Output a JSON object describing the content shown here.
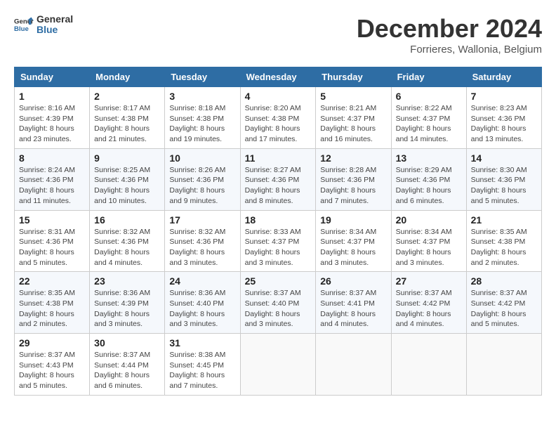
{
  "header": {
    "logo_general": "General",
    "logo_blue": "Blue",
    "month_year": "December 2024",
    "location": "Forrieres, Wallonia, Belgium"
  },
  "days_of_week": [
    "Sunday",
    "Monday",
    "Tuesday",
    "Wednesday",
    "Thursday",
    "Friday",
    "Saturday"
  ],
  "weeks": [
    [
      {
        "day": "1",
        "sunrise": "8:16 AM",
        "sunset": "4:39 PM",
        "daylight": "8 hours and 23 minutes."
      },
      {
        "day": "2",
        "sunrise": "8:17 AM",
        "sunset": "4:38 PM",
        "daylight": "8 hours and 21 minutes."
      },
      {
        "day": "3",
        "sunrise": "8:18 AM",
        "sunset": "4:38 PM",
        "daylight": "8 hours and 19 minutes."
      },
      {
        "day": "4",
        "sunrise": "8:20 AM",
        "sunset": "4:38 PM",
        "daylight": "8 hours and 17 minutes."
      },
      {
        "day": "5",
        "sunrise": "8:21 AM",
        "sunset": "4:37 PM",
        "daylight": "8 hours and 16 minutes."
      },
      {
        "day": "6",
        "sunrise": "8:22 AM",
        "sunset": "4:37 PM",
        "daylight": "8 hours and 14 minutes."
      },
      {
        "day": "7",
        "sunrise": "8:23 AM",
        "sunset": "4:36 PM",
        "daylight": "8 hours and 13 minutes."
      }
    ],
    [
      {
        "day": "8",
        "sunrise": "8:24 AM",
        "sunset": "4:36 PM",
        "daylight": "8 hours and 11 minutes."
      },
      {
        "day": "9",
        "sunrise": "8:25 AM",
        "sunset": "4:36 PM",
        "daylight": "8 hours and 10 minutes."
      },
      {
        "day": "10",
        "sunrise": "8:26 AM",
        "sunset": "4:36 PM",
        "daylight": "8 hours and 9 minutes."
      },
      {
        "day": "11",
        "sunrise": "8:27 AM",
        "sunset": "4:36 PM",
        "daylight": "8 hours and 8 minutes."
      },
      {
        "day": "12",
        "sunrise": "8:28 AM",
        "sunset": "4:36 PM",
        "daylight": "8 hours and 7 minutes."
      },
      {
        "day": "13",
        "sunrise": "8:29 AM",
        "sunset": "4:36 PM",
        "daylight": "8 hours and 6 minutes."
      },
      {
        "day": "14",
        "sunrise": "8:30 AM",
        "sunset": "4:36 PM",
        "daylight": "8 hours and 5 minutes."
      }
    ],
    [
      {
        "day": "15",
        "sunrise": "8:31 AM",
        "sunset": "4:36 PM",
        "daylight": "8 hours and 5 minutes."
      },
      {
        "day": "16",
        "sunrise": "8:32 AM",
        "sunset": "4:36 PM",
        "daylight": "8 hours and 4 minutes."
      },
      {
        "day": "17",
        "sunrise": "8:32 AM",
        "sunset": "4:36 PM",
        "daylight": "8 hours and 3 minutes."
      },
      {
        "day": "18",
        "sunrise": "8:33 AM",
        "sunset": "4:37 PM",
        "daylight": "8 hours and 3 minutes."
      },
      {
        "day": "19",
        "sunrise": "8:34 AM",
        "sunset": "4:37 PM",
        "daylight": "8 hours and 3 minutes."
      },
      {
        "day": "20",
        "sunrise": "8:34 AM",
        "sunset": "4:37 PM",
        "daylight": "8 hours and 3 minutes."
      },
      {
        "day": "21",
        "sunrise": "8:35 AM",
        "sunset": "4:38 PM",
        "daylight": "8 hours and 2 minutes."
      }
    ],
    [
      {
        "day": "22",
        "sunrise": "8:35 AM",
        "sunset": "4:38 PM",
        "daylight": "8 hours and 2 minutes."
      },
      {
        "day": "23",
        "sunrise": "8:36 AM",
        "sunset": "4:39 PM",
        "daylight": "8 hours and 3 minutes."
      },
      {
        "day": "24",
        "sunrise": "8:36 AM",
        "sunset": "4:40 PM",
        "daylight": "8 hours and 3 minutes."
      },
      {
        "day": "25",
        "sunrise": "8:37 AM",
        "sunset": "4:40 PM",
        "daylight": "8 hours and 3 minutes."
      },
      {
        "day": "26",
        "sunrise": "8:37 AM",
        "sunset": "4:41 PM",
        "daylight": "8 hours and 4 minutes."
      },
      {
        "day": "27",
        "sunrise": "8:37 AM",
        "sunset": "4:42 PM",
        "daylight": "8 hours and 4 minutes."
      },
      {
        "day": "28",
        "sunrise": "8:37 AM",
        "sunset": "4:42 PM",
        "daylight": "8 hours and 5 minutes."
      }
    ],
    [
      {
        "day": "29",
        "sunrise": "8:37 AM",
        "sunset": "4:43 PM",
        "daylight": "8 hours and 5 minutes."
      },
      {
        "day": "30",
        "sunrise": "8:37 AM",
        "sunset": "4:44 PM",
        "daylight": "8 hours and 6 minutes."
      },
      {
        "day": "31",
        "sunrise": "8:38 AM",
        "sunset": "4:45 PM",
        "daylight": "8 hours and 7 minutes."
      },
      null,
      null,
      null,
      null
    ]
  ],
  "labels": {
    "sunrise": "Sunrise:",
    "sunset": "Sunset:",
    "daylight": "Daylight:"
  }
}
